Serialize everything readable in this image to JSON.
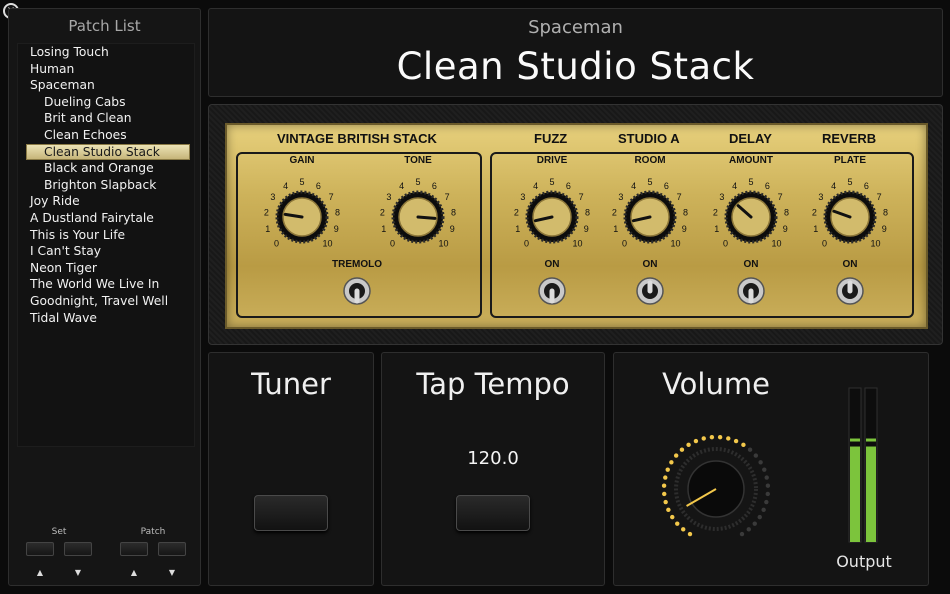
{
  "window": {
    "close_symbol": "×"
  },
  "sidebar": {
    "title": "Patch List",
    "patches": [
      {
        "label": "Losing Touch",
        "level": 0,
        "selected": false
      },
      {
        "label": "Human",
        "level": 0,
        "selected": false
      },
      {
        "label": "Spaceman",
        "level": 0,
        "selected": false
      },
      {
        "label": "Dueling Cabs",
        "level": 1,
        "selected": false
      },
      {
        "label": "Brit and Clean",
        "level": 1,
        "selected": false
      },
      {
        "label": "Clean Echoes",
        "level": 1,
        "selected": false
      },
      {
        "label": "Clean Studio Stack",
        "level": 1,
        "selected": true
      },
      {
        "label": "Black and Orange",
        "level": 1,
        "selected": false
      },
      {
        "label": "Brighton Slapback",
        "level": 1,
        "selected": false
      },
      {
        "label": "Joy Ride",
        "level": 0,
        "selected": false
      },
      {
        "label": "A Dustland Fairytale",
        "level": 0,
        "selected": false
      },
      {
        "label": "This is Your Life",
        "level": 0,
        "selected": false
      },
      {
        "label": "I Can't Stay",
        "level": 0,
        "selected": false
      },
      {
        "label": "Neon Tiger",
        "level": 0,
        "selected": false
      },
      {
        "label": "The World We Live In",
        "level": 0,
        "selected": false
      },
      {
        "label": "Goodnight, Travel Well",
        "level": 0,
        "selected": false
      },
      {
        "label": "Tidal Wave",
        "level": 0,
        "selected": false
      }
    ],
    "set_nav": {
      "label": "Set",
      "up": "▲",
      "down": "▼"
    },
    "patch_nav": {
      "label": "Patch",
      "up": "▲",
      "down": "▼"
    }
  },
  "header": {
    "set_name": "Spaceman",
    "patch_name": "Clean Studio Stack"
  },
  "amp": {
    "amp_model": "VINTAGE BRITISH STACK",
    "fx_headings": [
      "FUZZ",
      "STUDIO A",
      "DELAY",
      "REVERB"
    ],
    "scale": [
      "0",
      "1",
      "2",
      "3",
      "4",
      "5",
      "6",
      "7",
      "8",
      "9",
      "10"
    ],
    "knobs": [
      {
        "id": "gain",
        "label": "GAIN",
        "value": 2
      },
      {
        "id": "tone",
        "label": "TONE",
        "value": 8.5
      },
      {
        "id": "drive",
        "label": "DRIVE",
        "value": 1.2
      },
      {
        "id": "room",
        "label": "ROOM",
        "value": 1.2
      },
      {
        "id": "amount",
        "label": "AMOUNT",
        "value": 3.2
      },
      {
        "id": "plate",
        "label": "PLATE",
        "value": 2.4
      }
    ],
    "switches": [
      {
        "id": "tremolo",
        "label": "TREMOLO",
        "on": false
      },
      {
        "id": "fuzz",
        "label": "ON",
        "on": false
      },
      {
        "id": "studio",
        "label": "ON",
        "on": true
      },
      {
        "id": "delay",
        "label": "ON",
        "on": false
      },
      {
        "id": "reverb",
        "label": "ON",
        "on": true
      }
    ]
  },
  "tuner": {
    "title": "Tuner"
  },
  "tap_tempo": {
    "title": "Tap Tempo",
    "bpm": "120.0"
  },
  "volume": {
    "title": "Volume",
    "level": 0.62,
    "output_label": "Output",
    "meter_levels": [
      0.62,
      0.62
    ]
  },
  "colors": {
    "panel_gold": "#d6bd68",
    "meter_green": "#7cc43c",
    "led_amber": "#f3c84b"
  }
}
